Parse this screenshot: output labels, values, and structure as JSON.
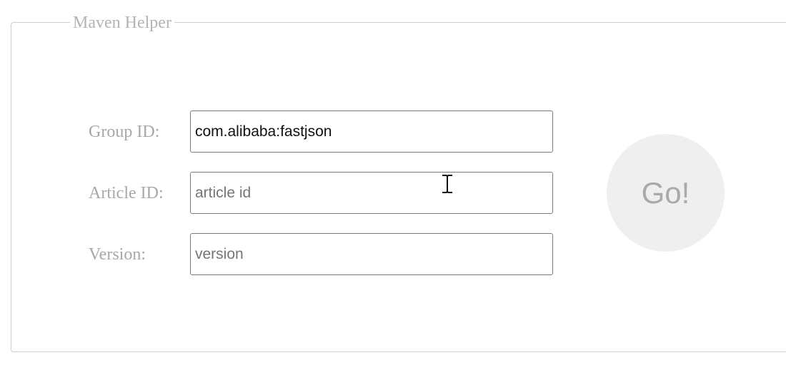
{
  "form": {
    "legend": "Maven Helper",
    "fields": [
      {
        "label": "Group ID:",
        "value": "com.alibaba:fastjson",
        "placeholder": ""
      },
      {
        "label": "Article ID:",
        "value": "",
        "placeholder": "article id"
      },
      {
        "label": "Version:",
        "value": "",
        "placeholder": "version"
      }
    ],
    "go_label": "Go!"
  },
  "cursor": {
    "icon": "text-cursor-icon"
  },
  "colors": {
    "border": "#cfcfcf",
    "label": "#a8a8a8",
    "button_bg": "#efefef",
    "button_text": "#a9a9a9"
  }
}
